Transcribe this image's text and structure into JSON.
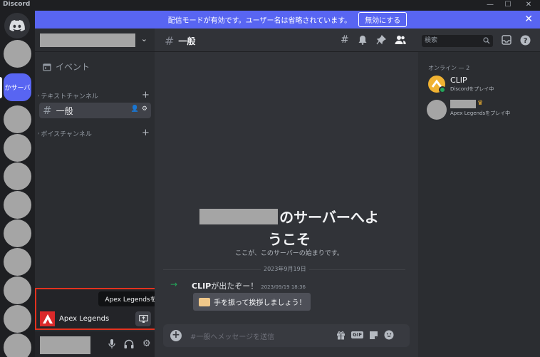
{
  "window": {
    "title": "Discord",
    "minimize": "—",
    "maximize": "☐",
    "close": "✕"
  },
  "banner": {
    "text": "配信モードが有効です。ユーザー名は省略されています。",
    "button": "無効にする",
    "close": "✕"
  },
  "servers": {
    "active_label": "かサーバ"
  },
  "sidebar": {
    "events": "イベント",
    "categories": [
      {
        "label": "テキストチャンネル"
      },
      {
        "label": "ボイスチャンネル"
      }
    ],
    "channel": "一般"
  },
  "activity": {
    "tooltip": "Apex Legendsを配信する",
    "game_name": "Apex Legends"
  },
  "chat": {
    "channel_name": "一般",
    "search_placeholder": "検索",
    "welcome_line1": "のサーバーへよ",
    "welcome_line2": "うこそ",
    "welcome_sub": "ここが、このサーバーの始まりです。",
    "date_divider": "2023年9月19日",
    "message": {
      "author": "CLIP",
      "text": "が出たぞー！",
      "time": "2023/09/19 18:36"
    },
    "wave_button": "手を振って挨拶しましょう！",
    "composer_placeholder": "#一般へメッセージを送信",
    "gif": "GIF"
  },
  "members": {
    "heading": "オンライン — 2",
    "list": [
      {
        "name": "CLIP",
        "activity": "Discordをプレイ中"
      },
      {
        "name": "",
        "activity": "Apex Legendsをプレイ中"
      }
    ]
  },
  "colors": {
    "accent": "#5865f2",
    "highlight_border": "#e3321f",
    "online": "#23a55a"
  }
}
